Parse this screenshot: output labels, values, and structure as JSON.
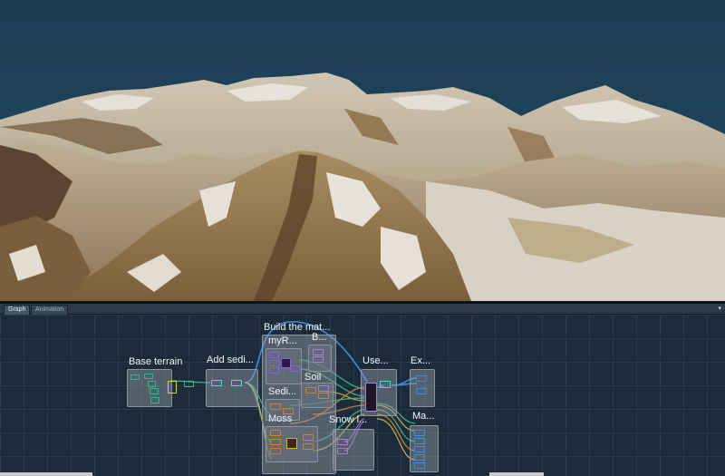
{
  "tabs": [
    {
      "label": "Graph",
      "active": true
    },
    {
      "label": "Animation",
      "active": false
    }
  ],
  "tab_menu_icon": "dropdown-arrow-icon",
  "graph": {
    "groups": {
      "base_terrain": "Base terrain",
      "add_sediment": "Add sedi...",
      "build_material": "Build the mat...",
      "my_rules": "myR...",
      "b": "B...",
      "soil": "Soil",
      "sediment": "Sedi...",
      "moss": "Moss",
      "snow": "Snow l...",
      "use": "Use...",
      "export": "Ex...",
      "material": "Ma..."
    }
  },
  "colors": {
    "sky": "#1e3f56",
    "grid_bg": "#1b2b39",
    "wire_blue": "#3d8ee0",
    "wire_green": "#3fb38a",
    "wire_yellow": "#c6b24a",
    "wire_orange": "#d0823a",
    "wire_purple": "#9a6ad0"
  }
}
